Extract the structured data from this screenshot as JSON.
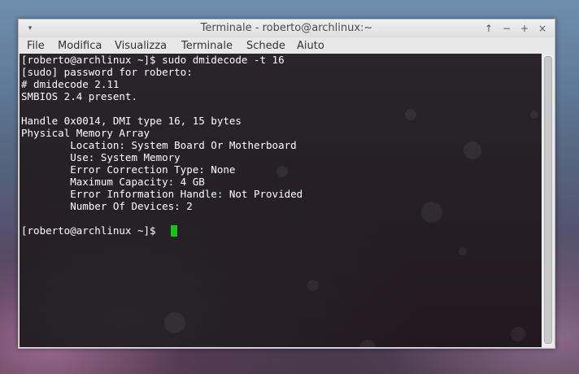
{
  "window": {
    "title": "Terminale - roberto@archlinux:~",
    "controls": {
      "menu_glyph": "▾",
      "shade": "↑",
      "minimize": "−",
      "maximize": "+",
      "close": "×"
    }
  },
  "menubar": {
    "items": [
      "File",
      "Modifica",
      "Visualizza",
      "Terminale",
      "Schede",
      "Aiuto"
    ]
  },
  "terminal": {
    "lines": [
      "[roberto@archlinux ~]$ sudo dmidecode -t 16",
      "[sudo] password for roberto:",
      "# dmidecode 2.11",
      "SMBIOS 2.4 present.",
      "",
      "Handle 0x0014, DMI type 16, 15 bytes",
      "Physical Memory Array",
      "        Location: System Board Or Motherboard",
      "        Use: System Memory",
      "        Error Correction Type: None",
      "        Maximum Capacity: 4 GB",
      "        Error Information Handle: Not Provided",
      "        Number Of Devices: 2",
      "",
      "[roberto@archlinux ~]$ "
    ],
    "cursor_color": "#19c219",
    "text_color": "#ffffff"
  }
}
